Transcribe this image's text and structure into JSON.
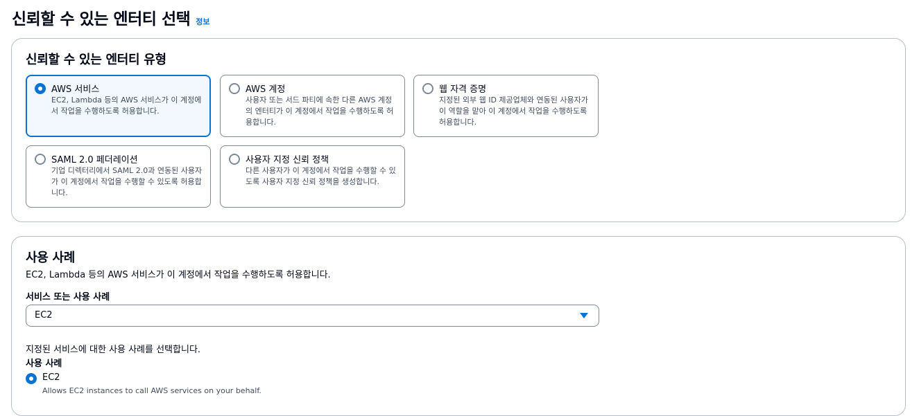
{
  "page": {
    "title": "신뢰할 수 있는 엔터티 선택",
    "info_link": "정보"
  },
  "entity_types": {
    "heading": "신뢰할 수 있는 엔터티 유형",
    "options": [
      {
        "title": "AWS 서비스",
        "desc": "EC2, Lambda 등의 AWS 서비스가 이 계정에서 작업을 수행하도록 허용합니다.",
        "selected": true
      },
      {
        "title": "AWS 계정",
        "desc": "사용자 또는 서드 파티에 속한 다른 AWS 계정의 엔터티가 이 계정에서 작업을 수행하도록 허용합니다.",
        "selected": false
      },
      {
        "title": "웹 자격 증명",
        "desc": "지정된 외부 웹 ID 제공업체와 연동된 사용자가 이 역할을 맡아 이 계정에서 작업을 수행하도록 허용합니다.",
        "selected": false
      },
      {
        "title": "SAML 2.0 페더레이션",
        "desc": "기업 디렉터리에서 SAML 2.0과 연동된 사용자가 이 계정에서 작업을 수행할 수 있도록 허용합니다.",
        "selected": false
      },
      {
        "title": "사용자 지정 신뢰 정책",
        "desc": "다른 사용자가 이 계정에서 작업을 수행할 수 있도록 사용자 지정 신뢰 정책을 생성합니다.",
        "selected": false
      }
    ]
  },
  "use_case": {
    "heading": "사용 사례",
    "description": "EC2, Lambda 등의 AWS 서비스가 이 계정에서 작업을 수행하도록 허용합니다.",
    "service_label": "서비스 또는 사용 사례",
    "service_value": "EC2",
    "hint": "지정된 서비스에 대한 사용 사례를 선택합니다.",
    "use_case_label": "사용 사례",
    "option": {
      "label": "EC2",
      "desc": "Allows EC2 instances to call AWS services on your behalf.",
      "selected": true
    }
  },
  "colors": {
    "accent": "#0972d3",
    "border": "#7d8998",
    "selected_bg": "#f2f8fd"
  }
}
